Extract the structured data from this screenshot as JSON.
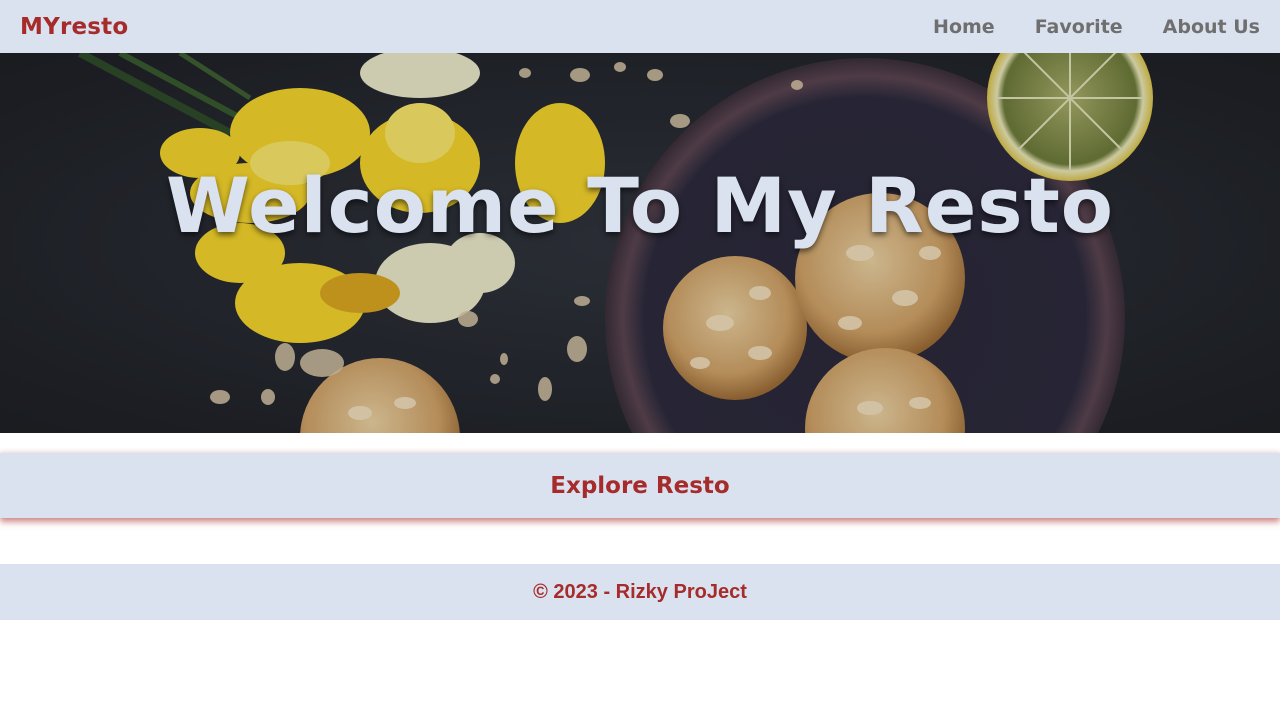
{
  "header": {
    "brand": "MYresto",
    "nav": [
      {
        "label": "Home"
      },
      {
        "label": "Favorite"
      },
      {
        "label": "About Us"
      }
    ]
  },
  "hero": {
    "title": "Welcome To My Resto",
    "image_icon": "hero-food-image"
  },
  "main": {
    "section_title": "Explore Resto"
  },
  "footer": {
    "text": "© 2023 - Rizky ProJect"
  },
  "colors": {
    "accent": "#a62b2b",
    "bar_background": "#dbe2ef",
    "nav_text": "#6f6f6f",
    "hero_text": "#dbe2ef"
  }
}
